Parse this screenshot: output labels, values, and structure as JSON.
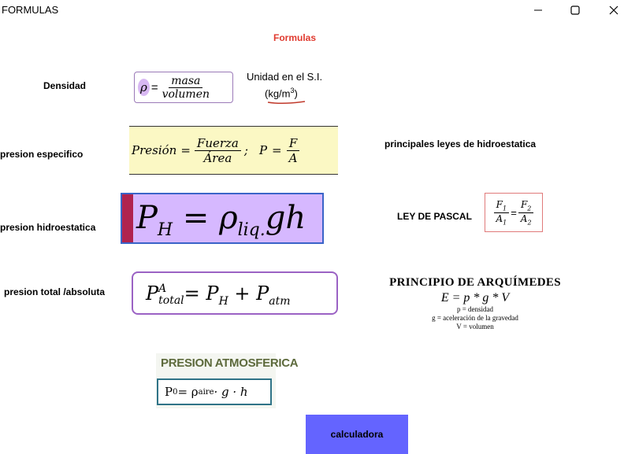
{
  "window": {
    "title": "FORMULAS",
    "controls": {
      "minimize": "—",
      "maximize": "☐",
      "close": "✕"
    }
  },
  "heading": {
    "text": "Formulas",
    "color": "#e03a2f"
  },
  "labels": {
    "densidad": "Densidad",
    "presion_especifico": "presion especifico",
    "presion_hidroestatica": "presion hidroestatica",
    "presion_total": "presion total /absoluta",
    "principales_leyes": "principales leyes de hidroestatica",
    "ley_pascal": "LEY DE PASCAL"
  },
  "formulas": {
    "densidad": {
      "rho": "ρ",
      "eq": "=",
      "num": "masa",
      "den": "volumen",
      "unit_label": "Unidad en el S.I.",
      "unit": "(kg/m",
      "unit_exp": "3",
      "unit_close": ")"
    },
    "presion": {
      "lhs": "Presión",
      "eq": "=",
      "num": "Fuerza",
      "den": "Área",
      "sep": ";",
      "p": "P",
      "eq2": "=",
      "num2": "F",
      "den2": "A"
    },
    "hidro": {
      "p": "P",
      "sub": "H",
      "eq": "=",
      "rho": "ρ",
      "rho_sub": "liq.",
      "gh": "gh"
    },
    "total": {
      "p": "P",
      "sup": "A",
      "sub": "total",
      "rest": "= P",
      "sub_h": "H",
      "plus": " + P",
      "sub_atm": "atm"
    },
    "pascal": {
      "f1": "F",
      "f1_sub": "1",
      "a1": "A",
      "a1_sub": "1",
      "eq": "=",
      "f2": "F",
      "f2_sub": "2",
      "a2": "A",
      "a2_sub": "2"
    },
    "arquimedes": {
      "title": "PRINCIPIO DE ARQUÍMEDES",
      "eq": "E = p * g * V",
      "l1": "p = densidad",
      "l2": "g = aceleración de la gravedad",
      "l3": "V = volumen"
    },
    "atmosferica": {
      "title": "PRESION ATMOSFERICA",
      "p": "P",
      "sub0": "0",
      "eq": " = ρ",
      "sub_aire": "aire",
      "rest": " · g · h"
    }
  },
  "buttons": {
    "calculadora": "calculadora"
  },
  "colors": {
    "button_bg": "#6464ff",
    "hidro_bg": "#d6b8ff",
    "presion_bg": "#fbf8c4",
    "heading": "#e03a2f"
  }
}
